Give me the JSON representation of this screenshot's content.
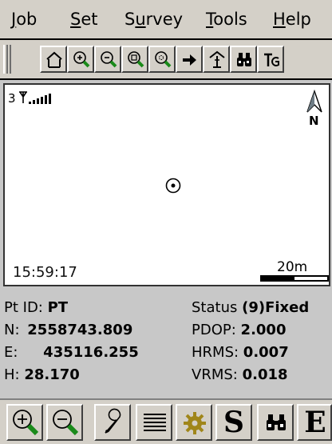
{
  "menu": {
    "items": [
      {
        "label": "Job",
        "u": "J",
        "rest": "ob"
      },
      {
        "label": "Set",
        "u": "S",
        "rest": "et"
      },
      {
        "label": "Survey",
        "pre": "S",
        "u": "u",
        "rest": "rvey"
      },
      {
        "label": "Tools",
        "u": "T",
        "rest": "ools"
      },
      {
        "label": "Help",
        "u": "H",
        "rest": "elp"
      }
    ]
  },
  "toolbar": {
    "buttons": [
      "home-icon",
      "zoom-in-icon",
      "zoom-out-icon",
      "zoom-window-icon",
      "zoom-extents-icon",
      "arrow-right-icon",
      "station-icon",
      "binoculars-icon",
      "text-icon"
    ]
  },
  "map": {
    "satellite_count": "3",
    "north_label": "N",
    "time": "15:59:17",
    "scale_label": "20m"
  },
  "info": {
    "pt_id_label": "Pt ID:",
    "pt_id_value": "PT",
    "n_label": "N:",
    "n_value": "2558743.809",
    "e_label": "E:",
    "e_value": "435116.255",
    "h_label": "H:",
    "h_value": "28.170",
    "status_label": "Status",
    "status_value": "(9)Fixed",
    "pdop_label": "PDOP:",
    "pdop_value": "2.000",
    "hrms_label": "HRMS:",
    "hrms_value": "0.007",
    "vrms_label": "VRMS:",
    "vrms_value": "0.018"
  },
  "bottombar": {
    "buttons": [
      "zoom-in-icon",
      "zoom-out-icon",
      "wrench-icon",
      "list-icon",
      "gear-icon",
      "s-icon",
      "binoculars-icon",
      "e-icon"
    ],
    "s_glyph": "S",
    "e_glyph": "E"
  },
  "colors": {
    "zoom_handle": "#1a8a1a",
    "background": "#c8c8c8"
  }
}
